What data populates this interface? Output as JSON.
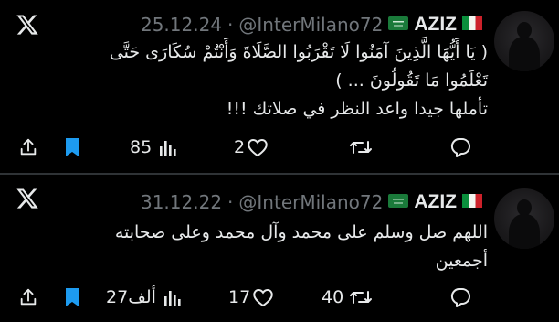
{
  "tweets": [
    {
      "date": "25.12.24",
      "dot": "·",
      "handle": "@InterMilano72",
      "name": "AZIZ",
      "text_line1": "( يَا أَيُّهَا الَّذِينَ آمَنُوا لَا تَقْرَبُوا الصَّلَاةَ وَأَنْتُمْ سُكَارَى حَتَّى",
      "text_line2": "تَعْلَمُوا مَا تَقُولُونَ ... )",
      "text_line3": "تأملها جيدا واعد النظر في صلاتك !!!",
      "views": "85",
      "likes": "2",
      "retweets": ""
    },
    {
      "date": "31.12.22",
      "dot": "·",
      "handle": "@InterMilano72",
      "name": "AZIZ",
      "text_line1": "اللهم صل وسلم على محمد وآل محمد وعلى صحابته",
      "text_line2": "أجمعين",
      "text_line3": "",
      "views": "27ألف",
      "likes": "17",
      "retweets": "40"
    }
  ],
  "icons": {
    "platform": "x-logo-icon",
    "flag_left": "saudi-flag-icon",
    "flag_right": "italy-flag-icon",
    "share": "share-icon",
    "bookmark": "bookmark-icon",
    "views": "views-icon",
    "like": "heart-icon",
    "retweet": "retweet-icon",
    "reply": "reply-icon"
  },
  "colors": {
    "background": "#000000",
    "text": "#e7e9ea",
    "secondary": "#71767b",
    "bookmark": "#1d9bf0",
    "divider": "#2f3336"
  }
}
